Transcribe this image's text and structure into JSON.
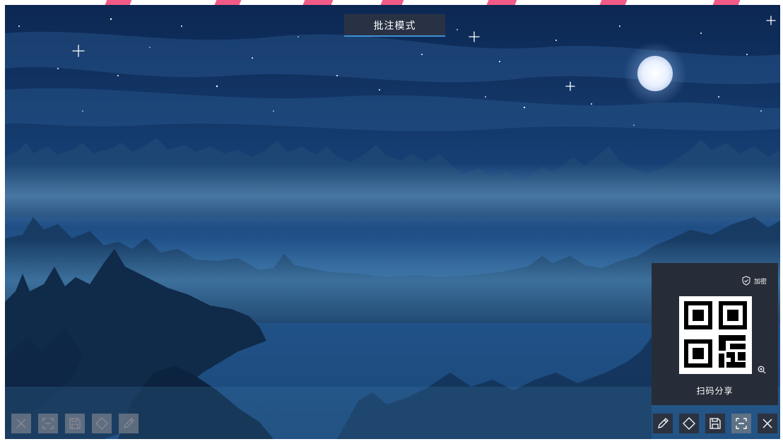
{
  "mode_banner": {
    "title": "批注模式"
  },
  "share_panel": {
    "encrypt_label": "加密",
    "scan_label": "扫码分享"
  },
  "left_toolbar": {
    "items": [
      "close-icon",
      "fullscreen-icon",
      "save-icon",
      "eraser-icon",
      "pen-icon"
    ]
  },
  "right_toolbar": {
    "items": [
      "pen-icon",
      "eraser-icon",
      "save-icon",
      "fullscreen-icon",
      "close-icon"
    ]
  },
  "colors": {
    "sky_top": "#0d2a55",
    "sky_mid": "#1f4e86",
    "fog": "#5b8fb8",
    "panel": "#262d38",
    "banner_underline": "#3f8fd3",
    "accent_pink": "#f25a87"
  }
}
